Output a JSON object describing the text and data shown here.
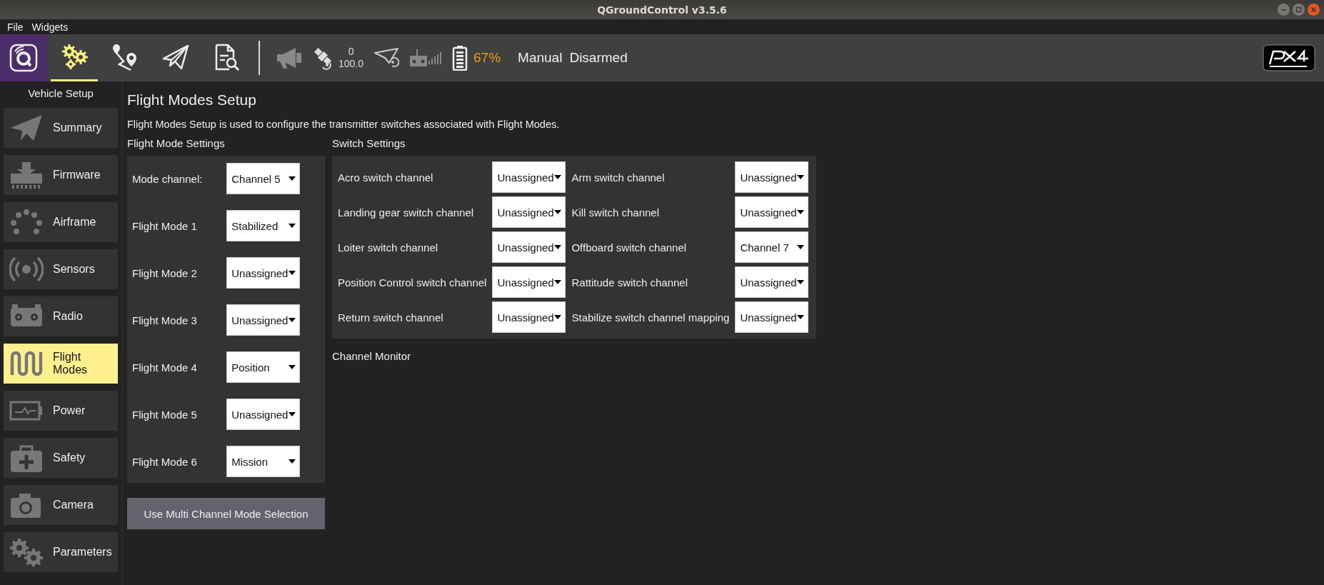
{
  "window": {
    "title": "QGroundControl v3.5.6"
  },
  "menu": [
    {
      "label": "File"
    },
    {
      "label": "Widgets"
    }
  ],
  "toolbar": {
    "views": [
      {
        "kind": "setup",
        "selected": true
      },
      {
        "kind": "plan",
        "selected": false
      },
      {
        "kind": "fly",
        "selected": false
      },
      {
        "kind": "analyze",
        "selected": false
      }
    ],
    "gps_count": "0",
    "gps_hdop": "100.0",
    "battery": "67%",
    "flight_mode": "Manual",
    "arm_state": "Disarmed"
  },
  "sidebar": {
    "title": "Vehicle Setup",
    "items": [
      {
        "kind": "summary",
        "label": "Summary",
        "selected": false
      },
      {
        "kind": "firmware",
        "label": "Firmware",
        "selected": false
      },
      {
        "kind": "airframe",
        "label": "Airframe",
        "selected": false
      },
      {
        "kind": "sensors",
        "label": "Sensors",
        "selected": false
      },
      {
        "kind": "radio",
        "label": "Radio",
        "selected": false
      },
      {
        "kind": "flightmodes",
        "label": "Flight Modes",
        "selected": true
      },
      {
        "kind": "power",
        "label": "Power",
        "selected": false
      },
      {
        "kind": "safety",
        "label": "Safety",
        "selected": false
      },
      {
        "kind": "camera",
        "label": "Camera",
        "selected": false
      },
      {
        "kind": "parameters",
        "label": "Parameters",
        "selected": false
      }
    ]
  },
  "page": {
    "title": "Flight Modes Setup",
    "description": "Flight Modes Setup is used to configure the transmitter switches associated with Flight Modes.",
    "flight_mode_settings": {
      "heading": "Flight Mode Settings",
      "rows": [
        {
          "label": "Mode channel:",
          "value": "Channel 5"
        },
        {
          "label": "Flight Mode 1",
          "value": "Stabilized"
        },
        {
          "label": "Flight Mode 2",
          "value": "Unassigned"
        },
        {
          "label": "Flight Mode 3",
          "value": "Unassigned"
        },
        {
          "label": "Flight Mode 4",
          "value": "Position"
        },
        {
          "label": "Flight Mode 5",
          "value": "Unassigned"
        },
        {
          "label": "Flight Mode 6",
          "value": "Mission"
        }
      ]
    },
    "multi_channel_button": "Use Multi Channel Mode Selection",
    "switch_settings": {
      "heading": "Switch Settings",
      "rows": [
        {
          "label": "Acro switch channel",
          "value": "Unassigned"
        },
        {
          "label": "Arm switch channel",
          "value": "Unassigned"
        },
        {
          "label": "Landing gear switch channel",
          "value": "Unassigned"
        },
        {
          "label": "Kill switch channel",
          "value": "Unassigned"
        },
        {
          "label": "Loiter switch channel",
          "value": "Unassigned"
        },
        {
          "label": "Offboard switch channel",
          "value": "Channel 7"
        },
        {
          "label": "Position Control switch channel",
          "value": "Unassigned"
        },
        {
          "label": "Rattitude switch channel",
          "value": "Unassigned"
        },
        {
          "label": "Return switch channel",
          "value": "Unassigned"
        },
        {
          "label": "Stabilize switch channel mapping",
          "value": "Unassigned"
        }
      ]
    },
    "channel_monitor": "Channel Monitor"
  }
}
